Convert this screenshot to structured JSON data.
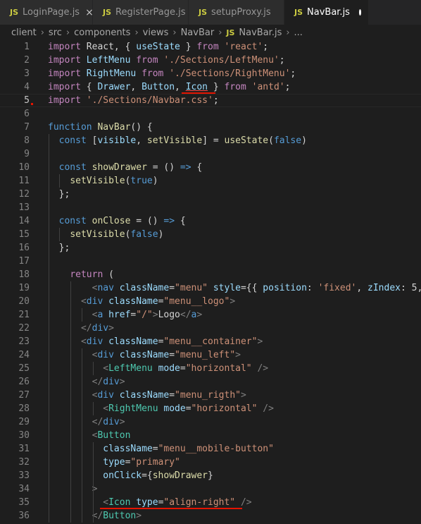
{
  "tabs": [
    {
      "badge": "JS",
      "label": "LoginPage.js",
      "close": "×"
    },
    {
      "badge": "JS",
      "label": "RegisterPage.js"
    },
    {
      "badge": "JS",
      "label": "setupProxy.js"
    },
    {
      "badge": "JS",
      "label": "NavBar.js"
    }
  ],
  "breadcrumb": [
    "client",
    "src",
    "components",
    "views",
    "NavBar",
    "NavBar.js",
    "..."
  ],
  "breadcrumb_badge": "JS",
  "separator": "›",
  "line_numbers": [
    "1",
    "2",
    "3",
    "4",
    "5",
    "6",
    "7",
    "8",
    "9",
    "10",
    "11",
    "12",
    "13",
    "14",
    "15",
    "16",
    "17",
    "18",
    "19",
    "20",
    "21",
    "22",
    "23",
    "24",
    "25",
    "26",
    "27",
    "28",
    "29",
    "30",
    "31",
    "32",
    "33",
    "34",
    "35",
    "36"
  ],
  "code": [
    [
      [
        "k",
        "import"
      ],
      [
        "d",
        " React, { "
      ],
      [
        "v",
        "useState"
      ],
      [
        "d",
        " } "
      ],
      [
        "k",
        "from"
      ],
      [
        "d",
        " "
      ],
      [
        "s",
        "'react'"
      ],
      [
        "d",
        ";"
      ]
    ],
    [
      [
        "k",
        "import"
      ],
      [
        "d",
        " "
      ],
      [
        "v",
        "LeftMenu"
      ],
      [
        "d",
        " "
      ],
      [
        "k",
        "from"
      ],
      [
        "d",
        " "
      ],
      [
        "s",
        "'./Sections/LeftMenu'"
      ],
      [
        "d",
        ";"
      ]
    ],
    [
      [
        "k",
        "import"
      ],
      [
        "d",
        " "
      ],
      [
        "v",
        "RightMenu"
      ],
      [
        "d",
        " "
      ],
      [
        "k",
        "from"
      ],
      [
        "d",
        " "
      ],
      [
        "s",
        "'./Sections/RightMenu'"
      ],
      [
        "d",
        ";"
      ]
    ],
    [
      [
        "k",
        "import"
      ],
      [
        "d",
        " { "
      ],
      [
        "v",
        "Drawer"
      ],
      [
        "d",
        ", "
      ],
      [
        "v",
        "Button"
      ],
      [
        "d",
        ", "
      ],
      [
        "vu",
        "Icon"
      ],
      [
        "d",
        " } "
      ],
      [
        "k",
        "from"
      ],
      [
        "d",
        " "
      ],
      [
        "s",
        "'antd'"
      ],
      [
        "d",
        ";"
      ]
    ],
    [
      [
        "k",
        "import"
      ],
      [
        "d",
        " "
      ],
      [
        "s",
        "'./Sections/Navbar.css'"
      ],
      [
        "d",
        ";"
      ]
    ],
    [],
    [
      [
        "b",
        "function"
      ],
      [
        "d",
        " "
      ],
      [
        "f",
        "NavBar"
      ],
      [
        "d",
        "() {"
      ]
    ],
    [
      [
        "d",
        "  "
      ],
      [
        "b",
        "const"
      ],
      [
        "d",
        " ["
      ],
      [
        "v",
        "visible"
      ],
      [
        "d",
        ", "
      ],
      [
        "f",
        "setVisible"
      ],
      [
        "d",
        "] = "
      ],
      [
        "f",
        "useState"
      ],
      [
        "d",
        "("
      ],
      [
        "b",
        "false"
      ],
      [
        "d",
        ")"
      ]
    ],
    [],
    [
      [
        "d",
        "  "
      ],
      [
        "b",
        "const"
      ],
      [
        "d",
        " "
      ],
      [
        "f",
        "showDrawer"
      ],
      [
        "d",
        " = () "
      ],
      [
        "b",
        "=>"
      ],
      [
        "d",
        " {"
      ]
    ],
    [
      [
        "d",
        "    "
      ],
      [
        "f",
        "setVisible"
      ],
      [
        "d",
        "("
      ],
      [
        "b",
        "true"
      ],
      [
        "d",
        ")"
      ]
    ],
    [
      [
        "d",
        "  };"
      ]
    ],
    [],
    [
      [
        "d",
        "  "
      ],
      [
        "b",
        "const"
      ],
      [
        "d",
        " "
      ],
      [
        "f",
        "onClose"
      ],
      [
        "d",
        " = () "
      ],
      [
        "b",
        "=>"
      ],
      [
        "d",
        " {"
      ]
    ],
    [
      [
        "d",
        "    "
      ],
      [
        "f",
        "setVisible"
      ],
      [
        "d",
        "("
      ],
      [
        "b",
        "false"
      ],
      [
        "d",
        ")"
      ]
    ],
    [
      [
        "d",
        "  };"
      ]
    ],
    [],
    [
      [
        "d",
        "    "
      ],
      [
        "k",
        "return"
      ],
      [
        "d",
        " ("
      ]
    ],
    [
      [
        "d",
        "        "
      ],
      [
        "p",
        "<"
      ],
      [
        "b",
        "nav"
      ],
      [
        "d",
        " "
      ],
      [
        "v",
        "className"
      ],
      [
        "d",
        "="
      ],
      [
        "s",
        "\"menu\""
      ],
      [
        "d",
        " "
      ],
      [
        "v",
        "style"
      ],
      [
        "d",
        "={{ "
      ],
      [
        "v",
        "position"
      ],
      [
        "d",
        ": "
      ],
      [
        "s",
        "'fixed'"
      ],
      [
        "d",
        ", "
      ],
      [
        "v",
        "zIndex"
      ],
      [
        "d",
        ": 5,"
      ]
    ],
    [
      [
        "d",
        "      "
      ],
      [
        "p",
        "<"
      ],
      [
        "b",
        "div"
      ],
      [
        "d",
        " "
      ],
      [
        "v",
        "className"
      ],
      [
        "d",
        "="
      ],
      [
        "s",
        "\"menu__logo\""
      ],
      [
        "p",
        ">"
      ]
    ],
    [
      [
        "d",
        "        "
      ],
      [
        "p",
        "<"
      ],
      [
        "b",
        "a"
      ],
      [
        "d",
        " "
      ],
      [
        "v",
        "href"
      ],
      [
        "d",
        "="
      ],
      [
        "s",
        "\"/\""
      ],
      [
        "p",
        ">"
      ],
      [
        "d",
        "Logo"
      ],
      [
        "p",
        "</"
      ],
      [
        "b",
        "a"
      ],
      [
        "p",
        ">"
      ]
    ],
    [
      [
        "d",
        "      "
      ],
      [
        "p",
        "</"
      ],
      [
        "b",
        "div"
      ],
      [
        "p",
        ">"
      ]
    ],
    [
      [
        "d",
        "      "
      ],
      [
        "p",
        "<"
      ],
      [
        "b",
        "div"
      ],
      [
        "d",
        " "
      ],
      [
        "v",
        "className"
      ],
      [
        "d",
        "="
      ],
      [
        "s",
        "\"menu__container\""
      ],
      [
        "p",
        ">"
      ]
    ],
    [
      [
        "d",
        "        "
      ],
      [
        "p",
        "<"
      ],
      [
        "b",
        "div"
      ],
      [
        "d",
        " "
      ],
      [
        "v",
        "className"
      ],
      [
        "d",
        "="
      ],
      [
        "s",
        "\"menu_left\""
      ],
      [
        "p",
        ">"
      ]
    ],
    [
      [
        "d",
        "          "
      ],
      [
        "p",
        "<"
      ],
      [
        "t",
        "LeftMenu"
      ],
      [
        "d",
        " "
      ],
      [
        "v",
        "mode"
      ],
      [
        "d",
        "="
      ],
      [
        "s",
        "\"horizontal\""
      ],
      [
        "d",
        " "
      ],
      [
        "p",
        "/>"
      ]
    ],
    [
      [
        "d",
        "        "
      ],
      [
        "p",
        "</"
      ],
      [
        "b",
        "div"
      ],
      [
        "p",
        ">"
      ]
    ],
    [
      [
        "d",
        "        "
      ],
      [
        "p",
        "<"
      ],
      [
        "b",
        "div"
      ],
      [
        "d",
        " "
      ],
      [
        "v",
        "className"
      ],
      [
        "d",
        "="
      ],
      [
        "s",
        "\"menu_rigth\""
      ],
      [
        "p",
        ">"
      ]
    ],
    [
      [
        "d",
        "          "
      ],
      [
        "p",
        "<"
      ],
      [
        "t",
        "RightMenu"
      ],
      [
        "d",
        " "
      ],
      [
        "v",
        "mode"
      ],
      [
        "d",
        "="
      ],
      [
        "s",
        "\"horizontal\""
      ],
      [
        "d",
        " "
      ],
      [
        "p",
        "/>"
      ]
    ],
    [
      [
        "d",
        "        "
      ],
      [
        "p",
        "</"
      ],
      [
        "b",
        "div"
      ],
      [
        "p",
        ">"
      ]
    ],
    [
      [
        "d",
        "        "
      ],
      [
        "p",
        "<"
      ],
      [
        "t",
        "Button"
      ]
    ],
    [
      [
        "d",
        "          "
      ],
      [
        "v",
        "className"
      ],
      [
        "d",
        "="
      ],
      [
        "s",
        "\"menu__mobile-button\""
      ]
    ],
    [
      [
        "d",
        "          "
      ],
      [
        "v",
        "type"
      ],
      [
        "d",
        "="
      ],
      [
        "s",
        "\"primary\""
      ]
    ],
    [
      [
        "d",
        "          "
      ],
      [
        "v",
        "onClick"
      ],
      [
        "d",
        "={"
      ],
      [
        "f",
        "showDrawer"
      ],
      [
        "d",
        "}"
      ]
    ],
    [
      [
        "d",
        "        "
      ],
      [
        "p",
        ">"
      ]
    ],
    [
      [
        "d",
        "          "
      ],
      [
        "p",
        "<"
      ],
      [
        "t",
        "Icon"
      ],
      [
        "d",
        " "
      ],
      [
        "v",
        "type"
      ],
      [
        "d",
        "="
      ],
      [
        "s",
        "\"align-right\""
      ],
      [
        "d",
        " "
      ],
      [
        "p",
        "/>"
      ]
    ],
    [
      [
        "d",
        "        "
      ],
      [
        "p",
        "</"
      ],
      [
        "t",
        "Button"
      ],
      [
        "p",
        ">"
      ]
    ]
  ],
  "current_line": "5",
  "colors": {
    "keyword": "#c586c0",
    "string": "#ce9178",
    "variable": "#9cdcfe",
    "function": "#dcdcaa",
    "builtin": "#569cd6",
    "component": "#4ec9b0",
    "punctuation": "#808080",
    "default": "#d4d4d4",
    "error_underline": "#e51400"
  }
}
